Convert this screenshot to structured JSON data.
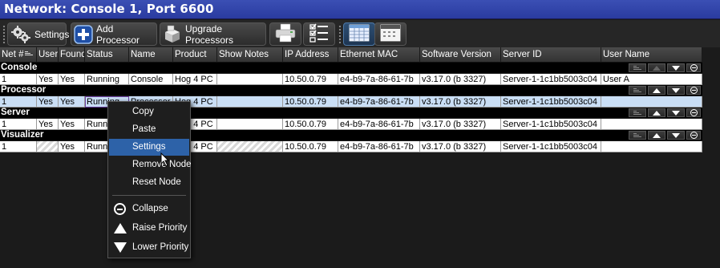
{
  "window": {
    "title": "Network: Console 1, Port 6600"
  },
  "toolbar": {
    "settings_label": "Settings",
    "add_processor_label": "Add Processor",
    "upgrade_processors_label": "Upgrade Processors",
    "icons": [
      "gears-icon",
      "add-plus-icon",
      "boxes-icon",
      "printer-icon",
      "checklist-icon",
      "grid-view-icon",
      "list-view-icon"
    ]
  },
  "table": {
    "headers": [
      "Net #",
      "User",
      "Found",
      "Status",
      "Name",
      "Product",
      "Show Notes",
      "IP Address",
      "Ethernet MAC",
      "Software Version",
      "Server ID",
      "User Name"
    ],
    "groups": [
      {
        "name": "Console",
        "row": [
          "1",
          "Yes",
          "Yes",
          "Running",
          "Console",
          "Hog 4 PC",
          "",
          "10.50.0.79",
          "e4-b9-7a-86-61-7b",
          "v3.17.0 (b 3327)",
          "Server-1-1c1bb5003c04",
          "User A"
        ]
      },
      {
        "name": "Processor",
        "row": [
          "1",
          "Yes",
          "Yes",
          "Running",
          "Processor",
          "Hog 4 PC",
          "",
          "10.50.0.79",
          "e4-b9-7a-86-61-7b",
          "v3.17.0 (b 3327)",
          "Server-1-1c1bb5003c04",
          ""
        ]
      },
      {
        "name": "Server",
        "row": [
          "1",
          "Yes",
          "Yes",
          "Running",
          "",
          "Hog 4 PC",
          "",
          "10.50.0.79",
          "e4-b9-7a-86-61-7b",
          "v3.17.0 (b 3327)",
          "Server-1-1c1bb5003c04",
          ""
        ]
      },
      {
        "name": "Visualizer",
        "row": [
          "1",
          "",
          "Yes",
          "Running",
          "",
          "Hog 4 PC",
          "",
          "10.50.0.79",
          "e4-b9-7a-86-61-7b",
          "v3.17.0 (b 3327)",
          "Server-1-1c1bb5003c04",
          ""
        ]
      }
    ],
    "selected_group": "Processor"
  },
  "context_menu": {
    "items": [
      "Copy",
      "Paste",
      "Settings",
      "Remove Node",
      "Reset Node",
      "Collapse",
      "Raise Priority",
      "Lower Priority"
    ],
    "highlighted": "Settings",
    "icons": [
      "collapse-icon",
      "raise-priority-icon",
      "lower-priority-icon"
    ]
  },
  "colors": {
    "title_bar": "#2f44aa",
    "selection": "#c9def5",
    "menu_highlight": "#2d62a8",
    "focus_outline": "#6b3fa0"
  }
}
